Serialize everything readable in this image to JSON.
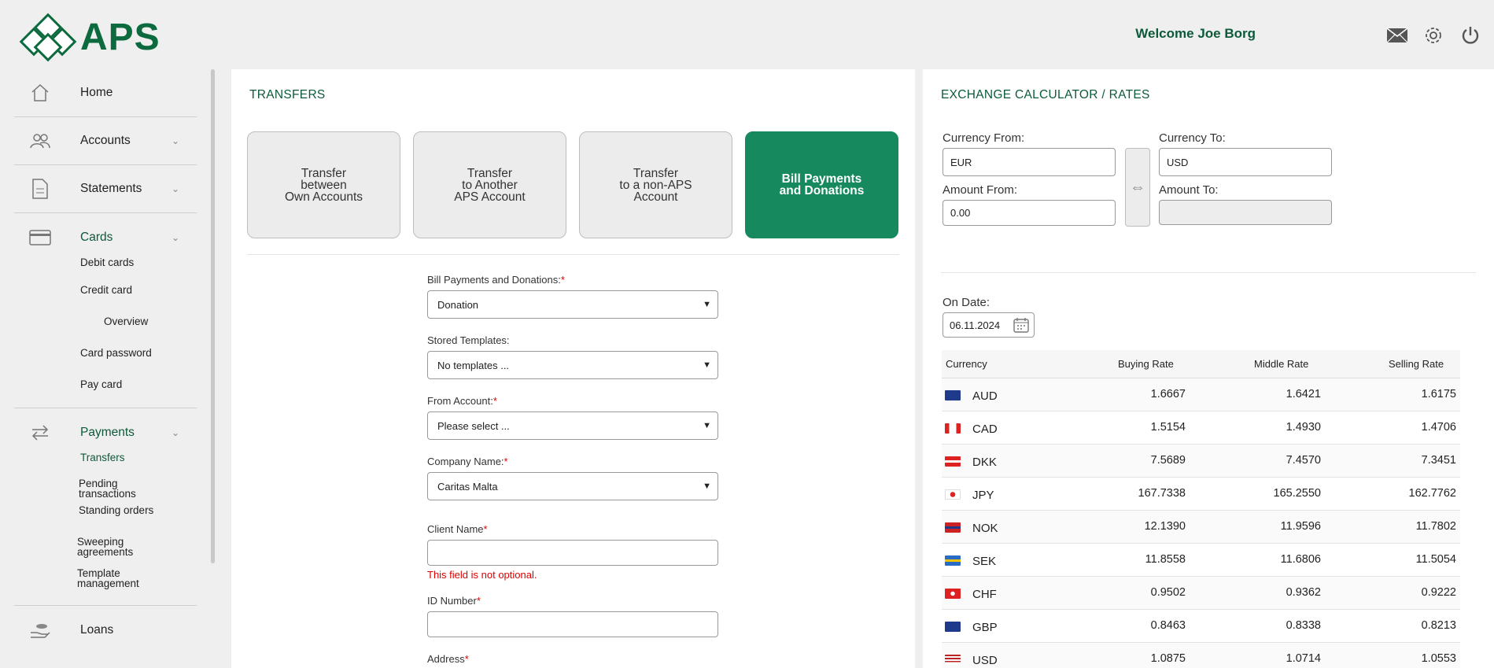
{
  "header": {
    "brand": "APS",
    "welcome": "Welcome Joe Borg",
    "icons": [
      "mail-icon",
      "settings-gear-icon",
      "power-logout-icon"
    ]
  },
  "sidebar": {
    "items": [
      {
        "label": "Home",
        "icon": "home-icon"
      },
      {
        "label": "Accounts",
        "icon": "users-icon"
      },
      {
        "label": "Statements",
        "icon": "document-icon"
      }
    ],
    "cards": {
      "label": "Cards",
      "icon": "credit-card-icon",
      "sub": [
        "Debit cards",
        "Credit card",
        "Overview",
        "Card password",
        "Pay card"
      ]
    },
    "payments": {
      "label": "Payments",
      "icon": "transfer-arrows-icon",
      "sub": [
        "Transfers",
        "Pending transactions",
        "Standing orders",
        "Sweeping agreements",
        "Template management"
      ]
    },
    "loans": {
      "label": "Loans",
      "icon": "hand-coins-icon"
    }
  },
  "transfers": {
    "title": "TRANSFERS",
    "tiles": [
      "Transfer\nbetween\nOwn Accounts",
      "Transfer\nto Another\nAPS Account",
      "Transfer\nto a non-APS\nAccount",
      "Bill Payments\nand Donations"
    ],
    "form": {
      "bill_label": "Bill Payments and Donations:",
      "bill_value": "Donation",
      "templates_label": "Stored Templates:",
      "templates_value": "No templates ...",
      "from_label": "From Account:",
      "from_value": "Please select ...",
      "company_label": "Company Name:",
      "company_value": "Caritas Malta",
      "client_label": "Client Name",
      "client_error": "This field is not optional.",
      "id_label": "ID Number",
      "address_label": "Address"
    }
  },
  "exchange": {
    "title": "EXCHANGE CALCULATOR / RATES",
    "currency_from_label": "Currency From:",
    "currency_from": "EUR",
    "currency_to_label": "Currency To:",
    "currency_to": "USD",
    "amount_from_label": "Amount From:",
    "amount_from": "0.00",
    "amount_to_label": "Amount To:",
    "on_date_label": "On Date:",
    "on_date": "06.11.2024",
    "columns": [
      "Currency",
      "Buying Rate",
      "Middle Rate",
      "Selling Rate"
    ],
    "rows": [
      {
        "ccy": "AUD",
        "buy": "1.6667",
        "mid": "1.6421",
        "sell": "1.6175"
      },
      {
        "ccy": "CAD",
        "buy": "1.5154",
        "mid": "1.4930",
        "sell": "1.4706"
      },
      {
        "ccy": "DKK",
        "buy": "7.5689",
        "mid": "7.4570",
        "sell": "7.3451"
      },
      {
        "ccy": "JPY",
        "buy": "167.7338",
        "mid": "165.2550",
        "sell": "162.7762"
      },
      {
        "ccy": "NOK",
        "buy": "12.1390",
        "mid": "11.9596",
        "sell": "11.7802"
      },
      {
        "ccy": "SEK",
        "buy": "11.8558",
        "mid": "11.6806",
        "sell": "11.5054"
      },
      {
        "ccy": "CHF",
        "buy": "0.9502",
        "mid": "0.9362",
        "sell": "0.9222"
      },
      {
        "ccy": "GBP",
        "buy": "0.8463",
        "mid": "0.8338",
        "sell": "0.8213"
      },
      {
        "ccy": "USD",
        "buy": "1.0875",
        "mid": "1.0714",
        "sell": "1.0553"
      }
    ]
  },
  "colors": {
    "brand": "#0d6a3f",
    "accent_tile": "#17895f",
    "error": "#dd0000"
  }
}
